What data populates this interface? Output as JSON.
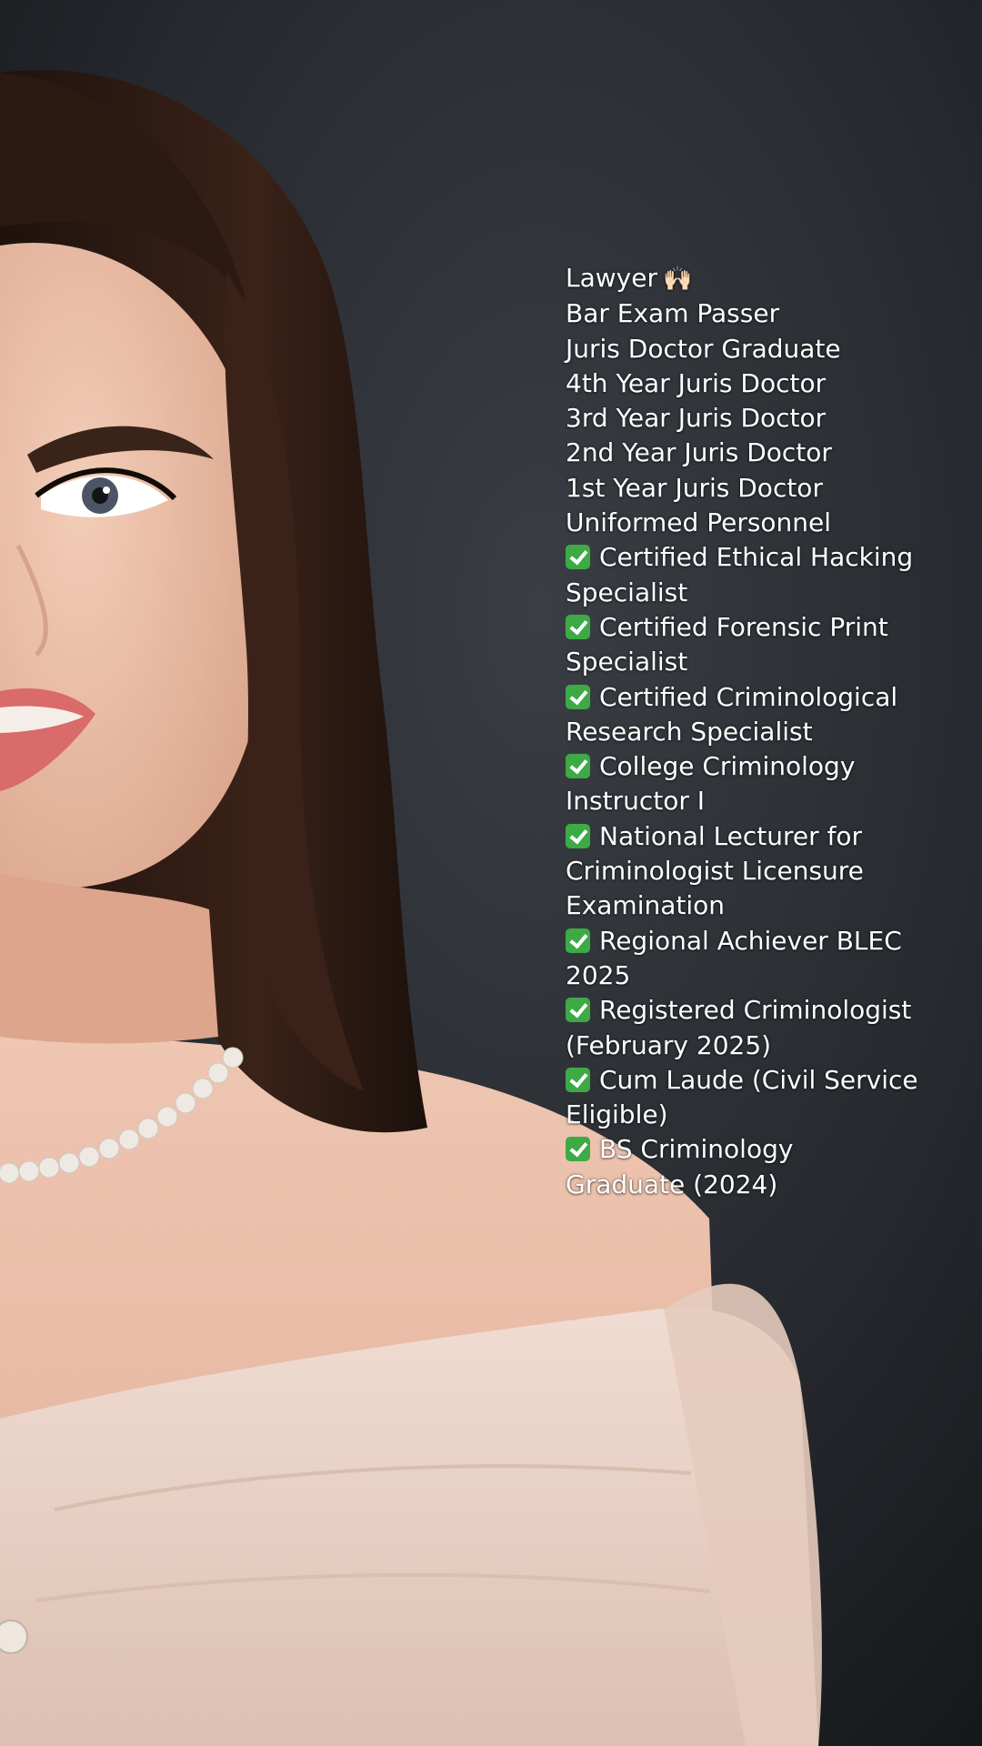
{
  "overlay": {
    "title_line": "Lawyer",
    "title_emoji": "🙌🏻",
    "lines": [
      "Bar Exam Passer",
      "Juris Doctor Graduate",
      "4th Year Juris Doctor",
      "3rd Year Juris Doctor",
      "2nd Year Juris Doctor",
      "1st Year Juris Doctor",
      "Uniformed Personnel"
    ],
    "checked_items": [
      "Certified Ethical Hacking Specialist",
      "Certified Forensic Print Specialist",
      "Certified Criminological Research Specialist",
      "College Criminology Instructor I",
      "National Lecturer for Criminologist Licensure Examination",
      "Regional Achiever BLEC 2025",
      "Registered Criminologist (February 2025)",
      "Cum Laude (Civil Service Eligible)",
      "BS Criminology Graduate (2024)"
    ],
    "check_icon": "check-mark-button-icon",
    "check_color": "#3daa45",
    "text_color": "#ffffff"
  },
  "photo": {
    "background_color": "#1f2226",
    "skin_color": "#e9b89f",
    "hair_color": "#2a1a14",
    "dress_color": "#e8d0c3",
    "pearl_color": "#efe9e4"
  }
}
